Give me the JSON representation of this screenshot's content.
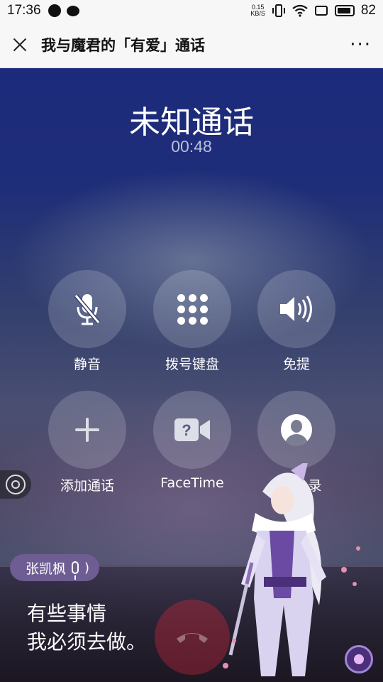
{
  "status_bar": {
    "time": "17:36",
    "net_speed_value": "0.15",
    "net_speed_unit": "KB/S",
    "battery": "82",
    "icons": [
      "chat-dot-icon",
      "chat-bubble-icon",
      "vibrate-icon",
      "wifi-icon",
      "screen-icon",
      "battery-icon"
    ]
  },
  "title_bar": {
    "title": "我与魔君的「有爱」通话",
    "more": "···"
  },
  "call": {
    "caller": "未知通话",
    "timer": "00:48"
  },
  "controls": [
    {
      "label": "静音",
      "icon": "mute-mic-icon"
    },
    {
      "label": "拨号键盘",
      "icon": "keypad-icon"
    },
    {
      "label": "免提",
      "icon": "speaker-icon"
    },
    {
      "label": "添加通话",
      "icon": "plus-icon"
    },
    {
      "label": "FaceTime",
      "icon": "facetime-icon"
    },
    {
      "label": "录",
      "icon": "contacts-icon"
    }
  ],
  "subtitle_panel": {
    "speaker": "张凯枫",
    "lines": [
      "有些事情",
      "我必须去做。"
    ]
  },
  "colors": {
    "speaker_pill": "#6d5d93",
    "end_call": "#dc283c"
  }
}
